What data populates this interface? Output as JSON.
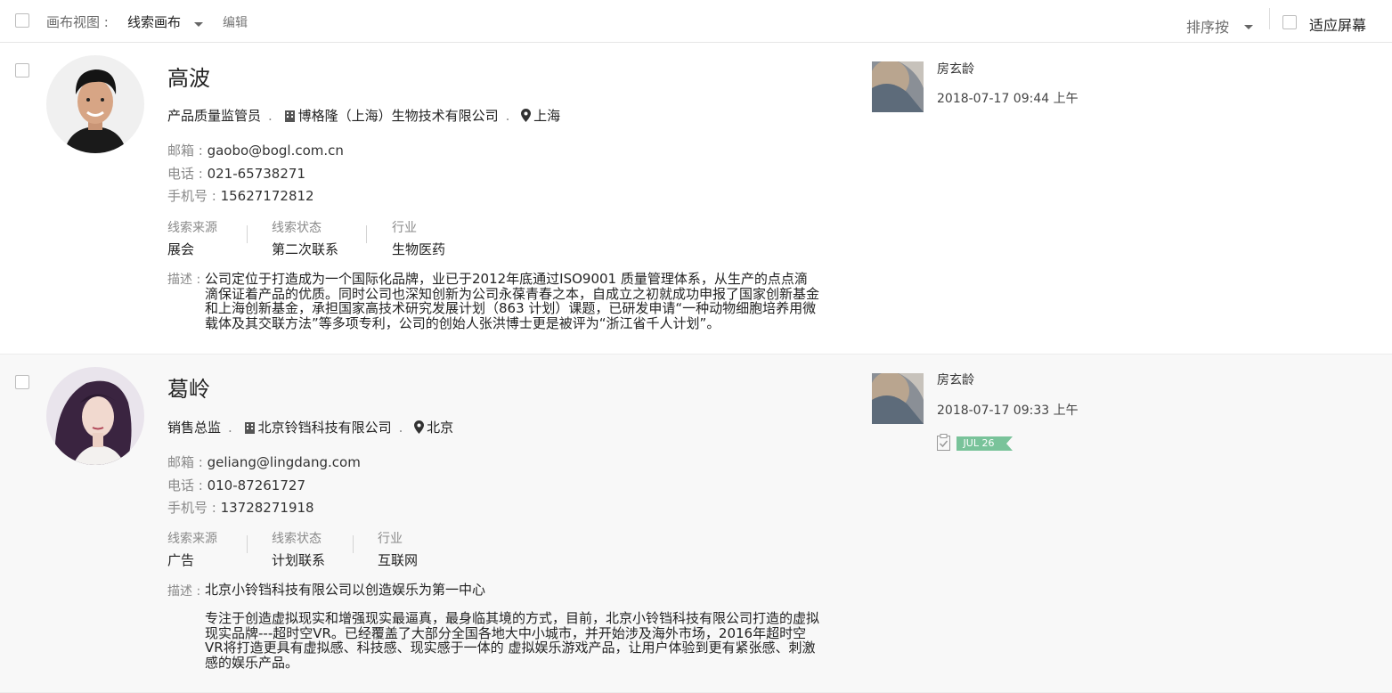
{
  "toolbar": {
    "view_label": "画布视图 :",
    "view_value": "线索画布",
    "edit_label": "编辑",
    "sort_label": "排序按",
    "fit_label": "适应屏幕"
  },
  "labels": {
    "email": "邮箱 : ",
    "phone": "电话 : ",
    "mobile": "手机号 : ",
    "source": "线索来源",
    "status": "线索状态",
    "industry": "行业",
    "desc": "描述 :"
  },
  "leads": [
    {
      "name": "高波",
      "title": "产品质量监管员",
      "company": "博格隆（上海）生物技术有限公司",
      "city": "上海",
      "email": "gaobo@bogl.com.cn",
      "phone": "021-65738271",
      "mobile": "15627172812",
      "source": "展会",
      "status": "第二次联系",
      "industry": "生物医药",
      "desc": "公司定位于打造成为一个国际化品牌，业已于2012年底通过ISO9001 质量管理体系，从生产的点点滴滴保证着产品的优质。同时公司也深知创新为公司永葆青春之本，自成立之初就成功申报了国家创新基金和上海创新基金，承担国家高技术研究发展计划（863 计划）课题，已研发申请“一种动物细胞培养用微载体及其交联方法”等多项专利，公司的创始人张洪博士更是被评为“浙江省千人计划”。",
      "owner": "房玄龄",
      "time": "2018-07-17 09:44 上午"
    },
    {
      "name": "葛岭",
      "title": "销售总监",
      "company": "北京铃铛科技有限公司",
      "city": "北京",
      "email": "geliang@lingdang.com",
      "phone": "010-87261727",
      "mobile": "13728271918",
      "source": "广告",
      "status": "计划联系",
      "industry": "互联网",
      "desc": "北京小铃铛科技有限公司以创造娱乐为第一中心",
      "desc2": "专注于创造虚拟现实和增强现实最逼真，最身临其境的方式，目前，北京小铃铛科技有限公司打造的虚拟现实品牌---超时空VR。已经覆盖了大部分全国各地大中小城市，并开始涉及海外市场，2016年超时空VR将打造更具有虚拟感、科技感、现实感于一体的 虚拟娱乐游戏产品，让用户体验到更有紧张感、刺激感的娱乐产品。",
      "owner": "房玄龄",
      "time": "2018-07-17 09:33 上午",
      "due": "JUL 26"
    }
  ],
  "colors": {
    "badge": "#79c39a",
    "muted": "#8a8a8a",
    "row_alt_bg": "#f8f8f8"
  }
}
